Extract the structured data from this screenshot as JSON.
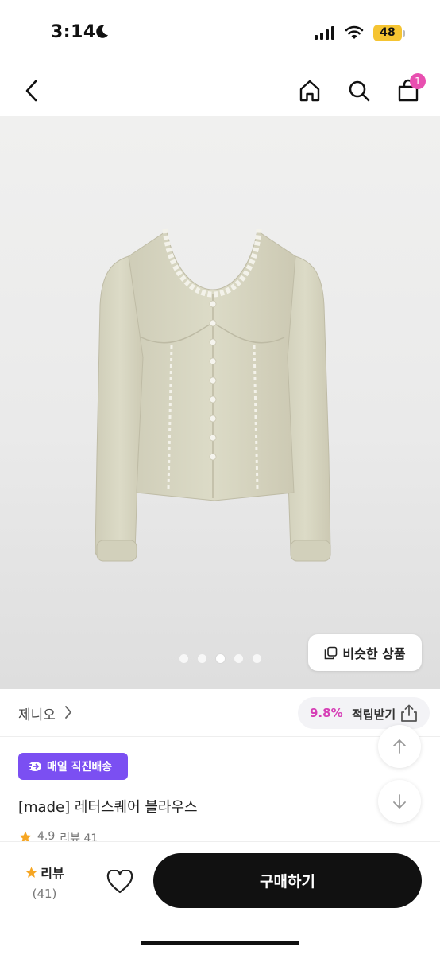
{
  "status_bar": {
    "time": "3:14",
    "battery": "48"
  },
  "nav": {
    "cart_count": "1"
  },
  "gallery": {
    "page_count": 5,
    "active_index": 2,
    "similar_label": "비슷한 상품"
  },
  "brand": {
    "name": "제니오",
    "reward_rate": "9.8%",
    "reward_label": "적립받기"
  },
  "product": {
    "delivery_badge": "매일 직진배송",
    "name": "[made] 레터스퀘어 블라우스",
    "rating": "4.9",
    "review_text": "리뷰 41"
  },
  "bottom_bar": {
    "review_label": "리뷰",
    "review_count": "(41)",
    "buy_label": "구매하기"
  },
  "colors": {
    "accent_pink": "#d63fb6",
    "badge_purple": "#7b4ff2",
    "star": "#f6a623",
    "buy_button": "#111111"
  }
}
